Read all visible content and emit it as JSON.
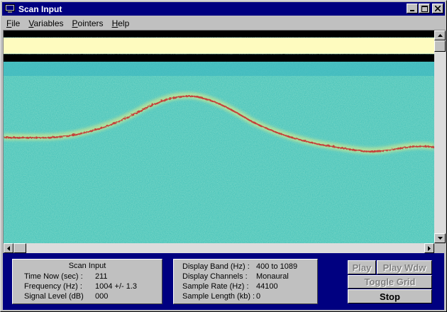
{
  "window": {
    "title": "Scan Input"
  },
  "menu": [
    {
      "label": "File",
      "key": "F",
      "rest": "ile"
    },
    {
      "label": "Variables",
      "key": "V",
      "rest": "ariables"
    },
    {
      "label": "Pointers",
      "key": "P",
      "rest": "ointers"
    },
    {
      "label": "Help",
      "key": "H",
      "rest": "elp"
    }
  ],
  "colors": {
    "titlebar": "#000080",
    "background_panel": "#000080",
    "face": "#c0c0c0",
    "spectro_base": "#4fc9b8",
    "trace": "#c4423a",
    "band": "#fefbbf"
  },
  "scan_panel": {
    "title": "Scan Input",
    "rows": [
      {
        "label": "Time Now (sec) :",
        "value": "211"
      },
      {
        "label": "Frequency (Hz) :",
        "value": "1004 +/- 1.3"
      },
      {
        "label": "Signal Level (dB)",
        "value": "000"
      }
    ]
  },
  "display_panel": {
    "rows": [
      {
        "label": "Display Band (Hz) :",
        "value": "400 to 1089"
      },
      {
        "label": "Display Channels :",
        "value": "Monaural"
      },
      {
        "label": "Sample Rate (Hz) :",
        "value": "44100"
      },
      {
        "label": "Sample Length (kb) :",
        "value": "0"
      }
    ]
  },
  "buttons": {
    "play": "Play",
    "play_wdw": "Play Wdw",
    "toggle_grid": "Toggle Grid",
    "stop": "Stop"
  },
  "icons": {
    "app": "monitor-icon",
    "minimize": "minimize-icon",
    "maximize": "maximize-icon",
    "close": "close-icon"
  }
}
